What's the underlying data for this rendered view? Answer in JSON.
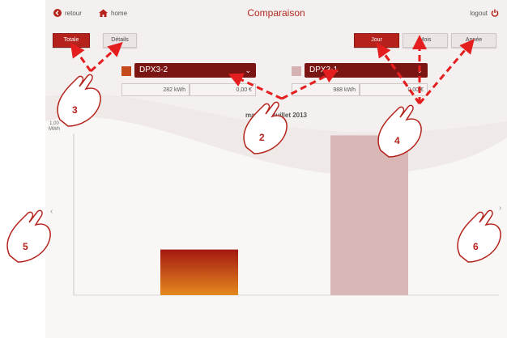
{
  "header": {
    "back_label": "retour",
    "home_label": "home",
    "title": "Comparaison",
    "logout_label": "logout"
  },
  "view_tabs": [
    {
      "label": "Totale",
      "active": true
    },
    {
      "label": "Détails",
      "active": false
    }
  ],
  "period_tabs": [
    {
      "label": "Jour",
      "active": true
    },
    {
      "label": "Mois",
      "active": false
    },
    {
      "label": "Année",
      "active": false
    }
  ],
  "series": [
    {
      "name": "DPX3-2",
      "color": "#c44a1c",
      "energy": "282 kWh",
      "cost": "0,00 €"
    },
    {
      "name": "DPX3-1",
      "color": "#d6b1b1",
      "energy": "988 kWh",
      "cost": "0,00 €"
    }
  ],
  "chart_data": {
    "type": "bar",
    "title": "mardi 16 juillet 2013",
    "ylabel_value": "1,00",
    "ylabel_unit": "MWh",
    "categories": [
      "DPX3-2",
      "DPX3-1"
    ],
    "values": [
      282,
      988
    ],
    "ylim": [
      0,
      1000
    ],
    "grid": false,
    "colors": [
      "#a82312",
      "#d9b7b7"
    ]
  },
  "callouts": [
    "2",
    "3",
    "4",
    "5",
    "6"
  ],
  "colors": {
    "accent": "#b4221b",
    "annotation": "#e41e1e"
  }
}
